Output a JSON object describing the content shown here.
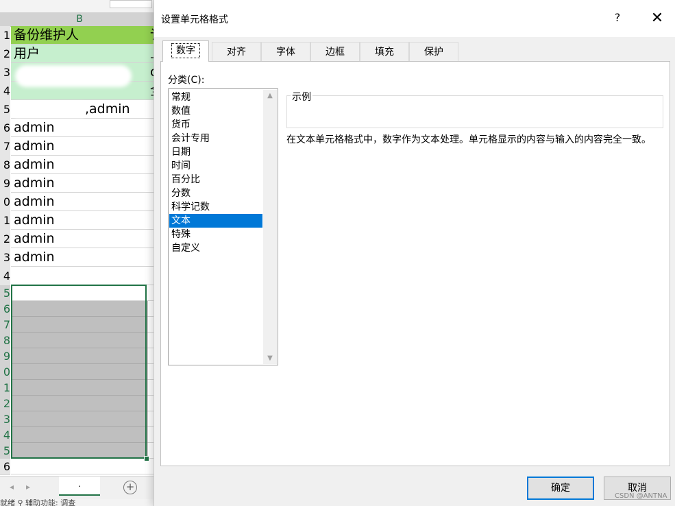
{
  "excel": {
    "column_header": "B",
    "rows": [
      {
        "num": "1",
        "value": "备份维护人",
        "style": "green-dark",
        "next": "讠"
      },
      {
        "num": "2",
        "value": "用户",
        "style": "green-light",
        "next": "上"
      },
      {
        "num": "3",
        "value": "",
        "style": "green-light",
        "next": "c"
      },
      {
        "num": "4",
        "value": "",
        "style": "green-light",
        "next": "全"
      },
      {
        "num": "5",
        "value": ",admin",
        "style": "blank",
        "next": ""
      },
      {
        "num": "6",
        "value": "admin",
        "style": "blank",
        "next": ""
      },
      {
        "num": "7",
        "value": "admin",
        "style": "blank",
        "next": ""
      },
      {
        "num": "8",
        "value": "admin",
        "style": "blank",
        "next": ""
      },
      {
        "num": "9",
        "value": "admin",
        "style": "blank",
        "next": ""
      },
      {
        "num": "0",
        "value": "admin",
        "style": "blank",
        "next": ""
      },
      {
        "num": "1",
        "value": "admin",
        "style": "blank",
        "next": ""
      },
      {
        "num": "2",
        "value": "admin",
        "style": "blank",
        "next": ""
      },
      {
        "num": "3",
        "value": "admin",
        "style": "blank",
        "next": ""
      },
      {
        "num": "4",
        "value": "",
        "style": "blank",
        "next": ""
      },
      {
        "num": "5",
        "value": "",
        "style": "blank",
        "next": ""
      },
      {
        "num": "6",
        "value": "",
        "style": "gray",
        "next": ""
      },
      {
        "num": "7",
        "value": "",
        "style": "gray",
        "next": ""
      },
      {
        "num": "8",
        "value": "",
        "style": "gray",
        "next": ""
      },
      {
        "num": "9",
        "value": "",
        "style": "gray",
        "next": ""
      },
      {
        "num": "0",
        "value": "",
        "style": "gray",
        "next": ""
      },
      {
        "num": "1",
        "value": "",
        "style": "gray",
        "next": ""
      },
      {
        "num": "2",
        "value": "",
        "style": "gray",
        "next": ""
      },
      {
        "num": "3",
        "value": "",
        "style": "gray",
        "next": ""
      },
      {
        "num": "4",
        "value": "",
        "style": "gray",
        "next": ""
      },
      {
        "num": "5",
        "value": "",
        "style": "gray",
        "next": ""
      },
      {
        "num": "6",
        "value": "",
        "style": "blank",
        "next": ""
      }
    ],
    "sheet_tab": ".",
    "add_sheet": "+",
    "nav_prev": "◂",
    "nav_next": "▸",
    "status_text": "就绪    ⚲ 辅助功能: 调查"
  },
  "dialog": {
    "title": "设置单元格格式",
    "help": "?",
    "close": "✕",
    "tabs": [
      "数字",
      "对齐",
      "字体",
      "边框",
      "填充",
      "保护"
    ],
    "active_tab": 0,
    "category_label": "分类(C):",
    "categories": [
      "常规",
      "数值",
      "货币",
      "会计专用",
      "日期",
      "时间",
      "百分比",
      "分数",
      "科学记数",
      "文本",
      "特殊",
      "自定义"
    ],
    "selected_category": 9,
    "sample_label": "示例",
    "description": "在文本单元格格式中，数字作为文本处理。单元格显示的内容与输入的内容完全一致。",
    "ok": "确定",
    "cancel": "取消"
  },
  "watermark": "CSDN @ANTNA",
  "colors": {
    "accent": "#0078d7",
    "excel_green": "#217346",
    "header_green": "#92d050",
    "light_green": "#c6efce",
    "gray_fill": "#bfbfbf"
  }
}
